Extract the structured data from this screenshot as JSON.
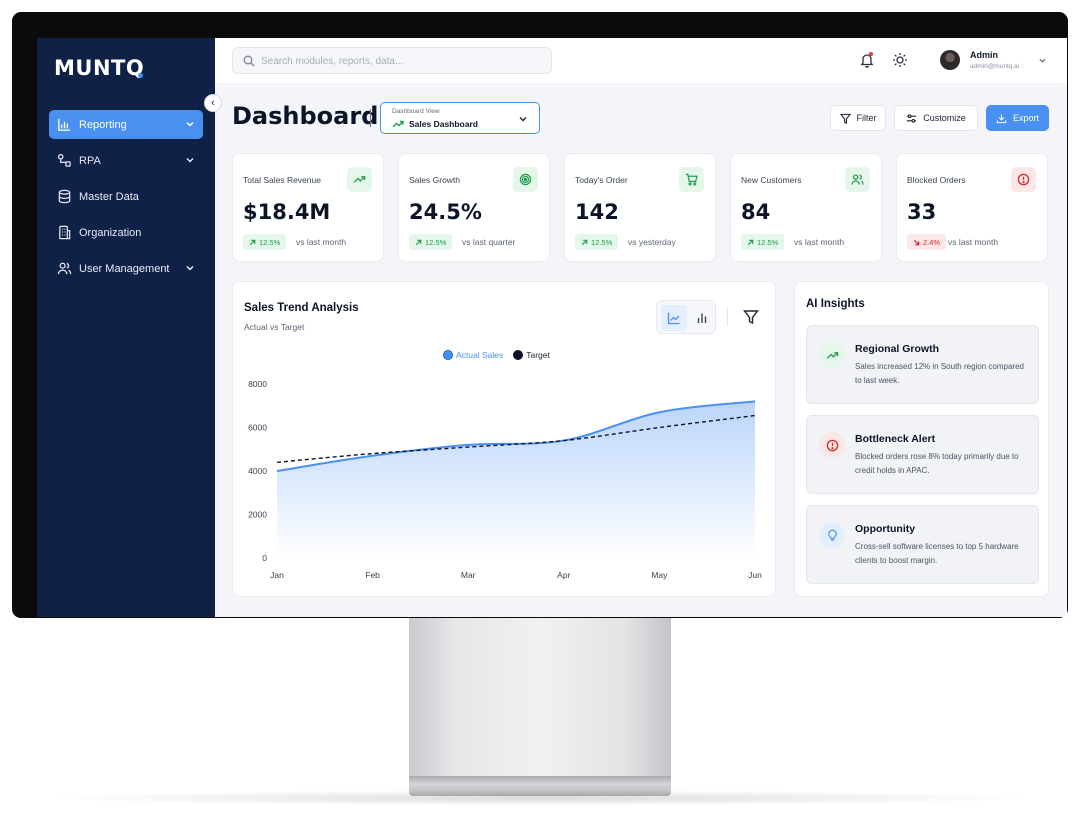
{
  "app": {
    "logo": "MUNTQ"
  },
  "sidebar": {
    "items": [
      {
        "label": "Reporting",
        "icon": "bar-chart-icon",
        "active": true,
        "expandable": true
      },
      {
        "label": "RPA",
        "icon": "workflow-icon",
        "active": false,
        "expandable": true
      },
      {
        "label": "Master Data",
        "icon": "database-icon",
        "active": false,
        "expandable": false
      },
      {
        "label": "Organization",
        "icon": "building-icon",
        "active": false,
        "expandable": false
      },
      {
        "label": "User Management",
        "icon": "users-icon",
        "active": false,
        "expandable": true
      }
    ]
  },
  "topbar": {
    "search_placeholder": "Search modules, reports, data...",
    "user": {
      "name": "Admin",
      "email": "admin@muntq.ai"
    }
  },
  "page": {
    "title": "Dashboard",
    "view_select": {
      "label": "Dashboard View",
      "value": "Sales Dashboard"
    },
    "actions": {
      "filter": "Filter",
      "customize": "Customize",
      "export": "Export"
    }
  },
  "kpis": [
    {
      "label": "Total Sales Revenue",
      "value": "$18.4M",
      "change": "12.5%",
      "direction": "up",
      "compare": "vs last month",
      "icon": "trend-up-icon"
    },
    {
      "label": "Sales Growth",
      "value": "24.5%",
      "change": "12.5%",
      "direction": "up",
      "compare": "vs last quarter",
      "icon": "target-icon"
    },
    {
      "label": "Today's Order",
      "value": "142",
      "change": "12.5%",
      "direction": "up",
      "compare": "vs yesterday",
      "icon": "cart-icon"
    },
    {
      "label": "New Customers",
      "value": "84",
      "change": "12.5%",
      "direction": "up",
      "compare": "vs last month",
      "icon": "users-icon"
    },
    {
      "label": "Blocked Orders",
      "value": "33",
      "change": "2.4%",
      "direction": "down",
      "compare": "vs last month",
      "icon": "alert-icon"
    }
  ],
  "chart_data": {
    "type": "line",
    "title": "Sales Trend Analysis",
    "subtitle": "Actual vs Target",
    "categories": [
      "Jan",
      "Feb",
      "Mar",
      "Apr",
      "May",
      "Jun"
    ],
    "series": [
      {
        "name": "Actual Sales",
        "values": [
          4000,
          4700,
          5200,
          5400,
          6700,
          7200
        ],
        "color": "#4a90f0"
      },
      {
        "name": "Target",
        "values": [
          4400,
          4800,
          5100,
          5400,
          6000,
          6550
        ],
        "color": "#0c1429"
      }
    ],
    "ylim": [
      0,
      8000
    ],
    "yticks": [
      0,
      2000,
      4000,
      6000,
      8000
    ],
    "legend": "top-center",
    "grid": false
  },
  "ai_insights": {
    "title": "AI Insights",
    "items": [
      {
        "title": "Regional Growth",
        "text": "Sales increased 12% in South region compared to last week.",
        "icon": "trend-up-icon",
        "tone": "green"
      },
      {
        "title": "Bottleneck Alert",
        "text": "Blocked orders rose 8% today primarily due to credit holds in APAC.",
        "icon": "alert-icon",
        "tone": "red"
      },
      {
        "title": "Opportunity",
        "text": "Cross-sell software licenses to top 5 hardware clients to boost margin.",
        "icon": "lightbulb-icon",
        "tone": "blue"
      }
    ]
  },
  "colors": {
    "sidebar": "#0f2147",
    "accent": "#4a90f0",
    "positive": "#1e9b4a",
    "negative": "#d42a2a"
  }
}
